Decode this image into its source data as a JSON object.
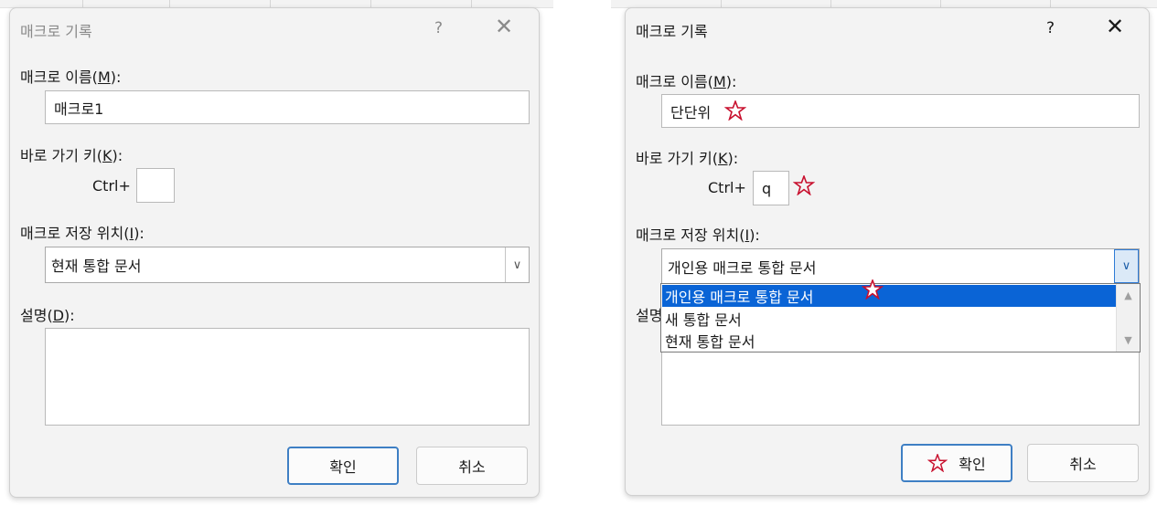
{
  "left_dialog": {
    "title": "매크로 기록",
    "help_label": "?",
    "close_label": "✕",
    "name_label_prefix": "매크로 이름(",
    "name_label_key": "M",
    "name_label_suffix": "):",
    "name_value": "매크로1",
    "shortcut_label_prefix": "바로 가기 키(",
    "shortcut_label_key": "K",
    "shortcut_label_suffix": "):",
    "ctrl_label": "Ctrl+",
    "shortcut_value": "",
    "store_label_prefix": "매크로 저장 위치(",
    "store_label_key": "I",
    "store_label_suffix": "):",
    "store_value": "현재 통합 문서",
    "desc_label_prefix": "설명(",
    "desc_label_key": "D",
    "desc_label_suffix": "):",
    "ok_label": "확인",
    "cancel_label": "취소"
  },
  "right_dialog": {
    "title": "매크로 기록",
    "help_label": "?",
    "close_label": "✕",
    "name_label_prefix": "매크로 이름(",
    "name_label_key": "M",
    "name_label_suffix": "):",
    "name_value": "단단위",
    "shortcut_label_prefix": "바로 가기 키(",
    "shortcut_label_key": "K",
    "shortcut_label_suffix": "):",
    "ctrl_label": "Ctrl+",
    "shortcut_value": "q",
    "store_label_prefix": "매크로 저장 위치(",
    "store_label_key": "I",
    "store_label_suffix": "):",
    "store_value": "개인용 매크로 통합 문서",
    "dropdown_options": [
      "개인용 매크로 통합 문서",
      "새 통합 문서",
      "현재 통합 문서"
    ],
    "desc_label_partial": "설명",
    "ok_label": "확인",
    "cancel_label": "취소"
  },
  "icons": {
    "combo_arrow": "chevron-down-icon",
    "scroll_up": "scroll-up-arrow-icon",
    "scroll_down": "scroll-down-arrow-icon",
    "annotation_star": "star-annotation-icon"
  },
  "colors": {
    "selection": "#0a64d6",
    "primary_button_border": "#3e7fc4",
    "annotation_star": "#c8102e"
  }
}
